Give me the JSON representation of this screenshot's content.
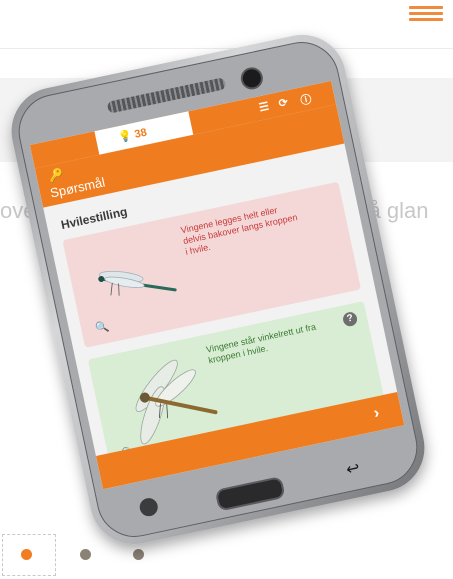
{
  "background": {
    "text_left": "ove",
    "text_right": "r blå glan",
    "menu_icon": "hamburger-menu-icon",
    "pagination": {
      "active_index": 0,
      "count": 3
    }
  },
  "app": {
    "points": "38",
    "status_icons": [
      "lightbulb-icon",
      "list-icon",
      "refresh-icon",
      "info-icon"
    ],
    "header_title": "Spørsmål",
    "section_title": "Hvilestilling",
    "options": [
      {
        "text": "Vingene legges helt eller delvis bakover langs kroppen i hvile.",
        "color": "#f4d8d8"
      },
      {
        "text": "Vingene står vinkelrett ut fra kroppen i hvile.",
        "color": "#d9edd5"
      }
    ]
  },
  "colors": {
    "accent": "#ef7d1f",
    "wrong": "#f4d8d8",
    "correct": "#d9edd5"
  }
}
